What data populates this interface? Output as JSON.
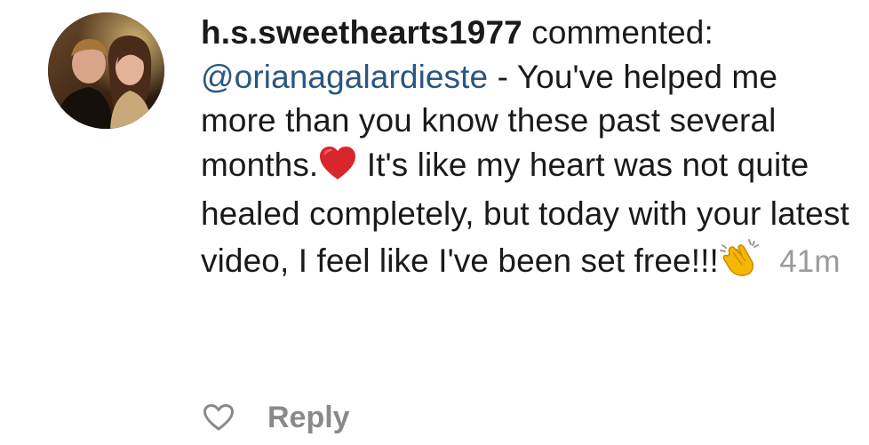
{
  "comment": {
    "username": "h.s.sweethearts1977",
    "action_text": "commented:",
    "mention": "@orianagalardieste",
    "text_part1": "- You've helped me more than you know these past several months.",
    "text_part2": "It's like my heart was not quite healed completely, but today with  your latest video, I feel like I've been set free!!!",
    "emoji_1": "red-heart",
    "emoji_2": "clapping-hands",
    "timestamp": "41m"
  },
  "actions": {
    "like_icon": "heart-outline-icon",
    "reply_label": "Reply"
  },
  "colors": {
    "text": "#1a1a1a",
    "mention": "#2a5680",
    "muted": "#9b9b9b",
    "heart": "#d9262c",
    "clap": "#f5b800"
  }
}
